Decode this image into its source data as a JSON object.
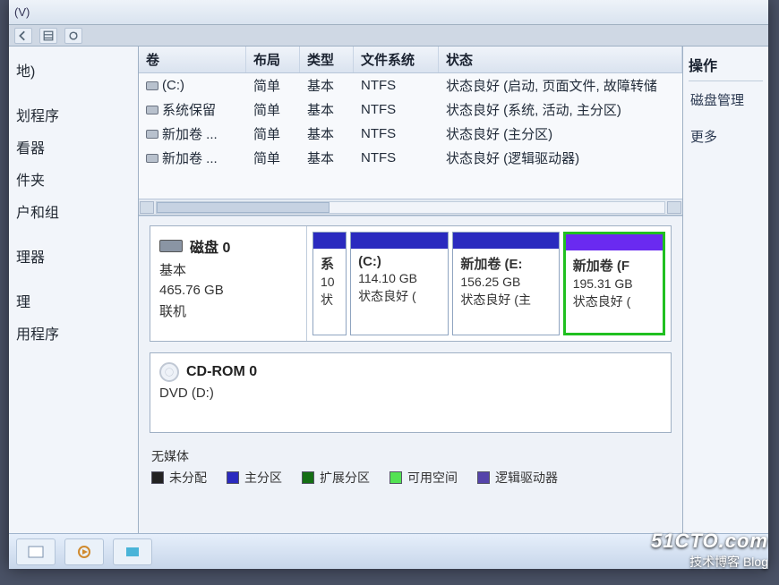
{
  "toolbar": {
    "menu": "(V)"
  },
  "sidebar": {
    "items": [
      "地)",
      "划程序",
      "看器",
      "件夹",
      "户和组",
      "",
      "理器",
      "",
      "理",
      "用程序"
    ]
  },
  "table": {
    "headers": {
      "vol": "卷",
      "layout": "布局",
      "type": "类型",
      "fs": "文件系统",
      "status": "状态"
    },
    "rows": [
      {
        "vol": "(C:)",
        "layout": "简单",
        "type": "基本",
        "fs": "NTFS",
        "status": "状态良好 (启动, 页面文件, 故障转储"
      },
      {
        "vol": "系统保留",
        "layout": "简单",
        "type": "基本",
        "fs": "NTFS",
        "status": "状态良好 (系统, 活动, 主分区)"
      },
      {
        "vol": "新加卷 ...",
        "layout": "简单",
        "type": "基本",
        "fs": "NTFS",
        "status": "状态良好 (主分区)"
      },
      {
        "vol": "新加卷 ...",
        "layout": "简单",
        "type": "基本",
        "fs": "NTFS",
        "status": "状态良好 (逻辑驱动器)"
      }
    ]
  },
  "disk0": {
    "title": "磁盘 0",
    "type": "基本",
    "size": "465.76 GB",
    "state": "联机",
    "parts": [
      {
        "name": "系",
        "size": "10",
        "status": "状",
        "flex": "0.4"
      },
      {
        "name": "(C:)",
        "size": "114.10 GB",
        "status": "状态良好 (",
        "flex": "1.2"
      },
      {
        "name": "新加卷  (E:",
        "size": "156.25 GB",
        "status": "状态良好 (主",
        "flex": "1.3"
      },
      {
        "name": "新加卷  (F",
        "size": "195.31 GB",
        "status": "状态良好 (",
        "flex": "1.2",
        "selected": true
      }
    ]
  },
  "cdrom": {
    "title": "CD-ROM 0",
    "sub": "DVD (D:)",
    "nomedia": "无媒体"
  },
  "legend": {
    "unalloc": "未分配",
    "primary": "主分区",
    "ext": "扩展分区",
    "free": "可用空间",
    "logical": "逻辑驱动器"
  },
  "rightbar": {
    "title": "操作",
    "line1": "磁盘管理",
    "line2": "更多"
  },
  "watermark": {
    "l1": "51CTO.com",
    "l2": "技术博客   Blog"
  }
}
